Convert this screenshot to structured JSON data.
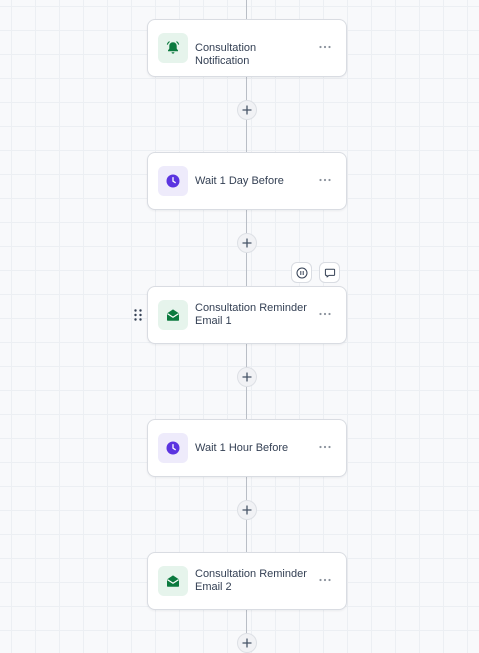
{
  "workflow": {
    "steps": [
      {
        "label": "Consultation Notification",
        "type": "notification",
        "icon": "bell-icon",
        "accent": "#0b7a3f"
      },
      {
        "label": "Wait 1 Day Before",
        "type": "wait",
        "icon": "clock-icon",
        "accent": "#5b34e0"
      },
      {
        "label": "Consultation Reminder Email 1",
        "type": "email",
        "icon": "mail-open-icon",
        "accent": "#0b7a3f"
      },
      {
        "label": "Wait 1 Hour Before",
        "type": "wait",
        "icon": "clock-icon",
        "accent": "#5b34e0"
      },
      {
        "label": "Consultation Reminder Email 2",
        "type": "email",
        "icon": "mail-open-icon",
        "accent": "#0b7a3f"
      }
    ],
    "hovered_step_actions": [
      "pause-icon",
      "comment-icon"
    ],
    "colors": {
      "connector": "#b9bec6",
      "card_border": "#d9dce2",
      "text": "#344054",
      "green_icon_bg": "#e6f4ec",
      "purple_icon_bg": "#eeebfb"
    }
  }
}
